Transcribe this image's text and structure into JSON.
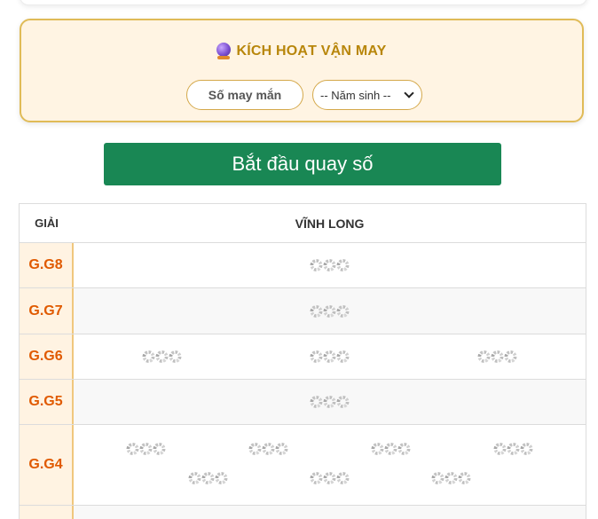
{
  "luck_panel": {
    "title": "KÍCH HOẠT VẬN MAY",
    "title_icon": "crystal-ball-icon",
    "lucky_number_placeholder": "Số may mắn",
    "birth_year_selected": "-- Năm sinh --"
  },
  "start_button": {
    "label": "Bắt đầu quay số",
    "color": "#198754"
  },
  "results_table": {
    "prize_header": "GIẢI",
    "province_header": "VĨNH LONG",
    "placeholder_icon": "loading-spinner-icon",
    "rows": [
      {
        "label": "G.G8",
        "slots": 1
      },
      {
        "label": "G.G7",
        "slots": 1
      },
      {
        "label": "G.G6",
        "slots": 3
      },
      {
        "label": "G.G5",
        "slots": 1
      },
      {
        "label": "G.G4",
        "slots": 7
      }
    ]
  },
  "colors": {
    "accent_gold": "#b8860b",
    "panel_border": "#e0bb57",
    "panel_background": "#fff4e3",
    "prize_label": "#e05a00",
    "prize_cell_background": "#fff3e2"
  }
}
